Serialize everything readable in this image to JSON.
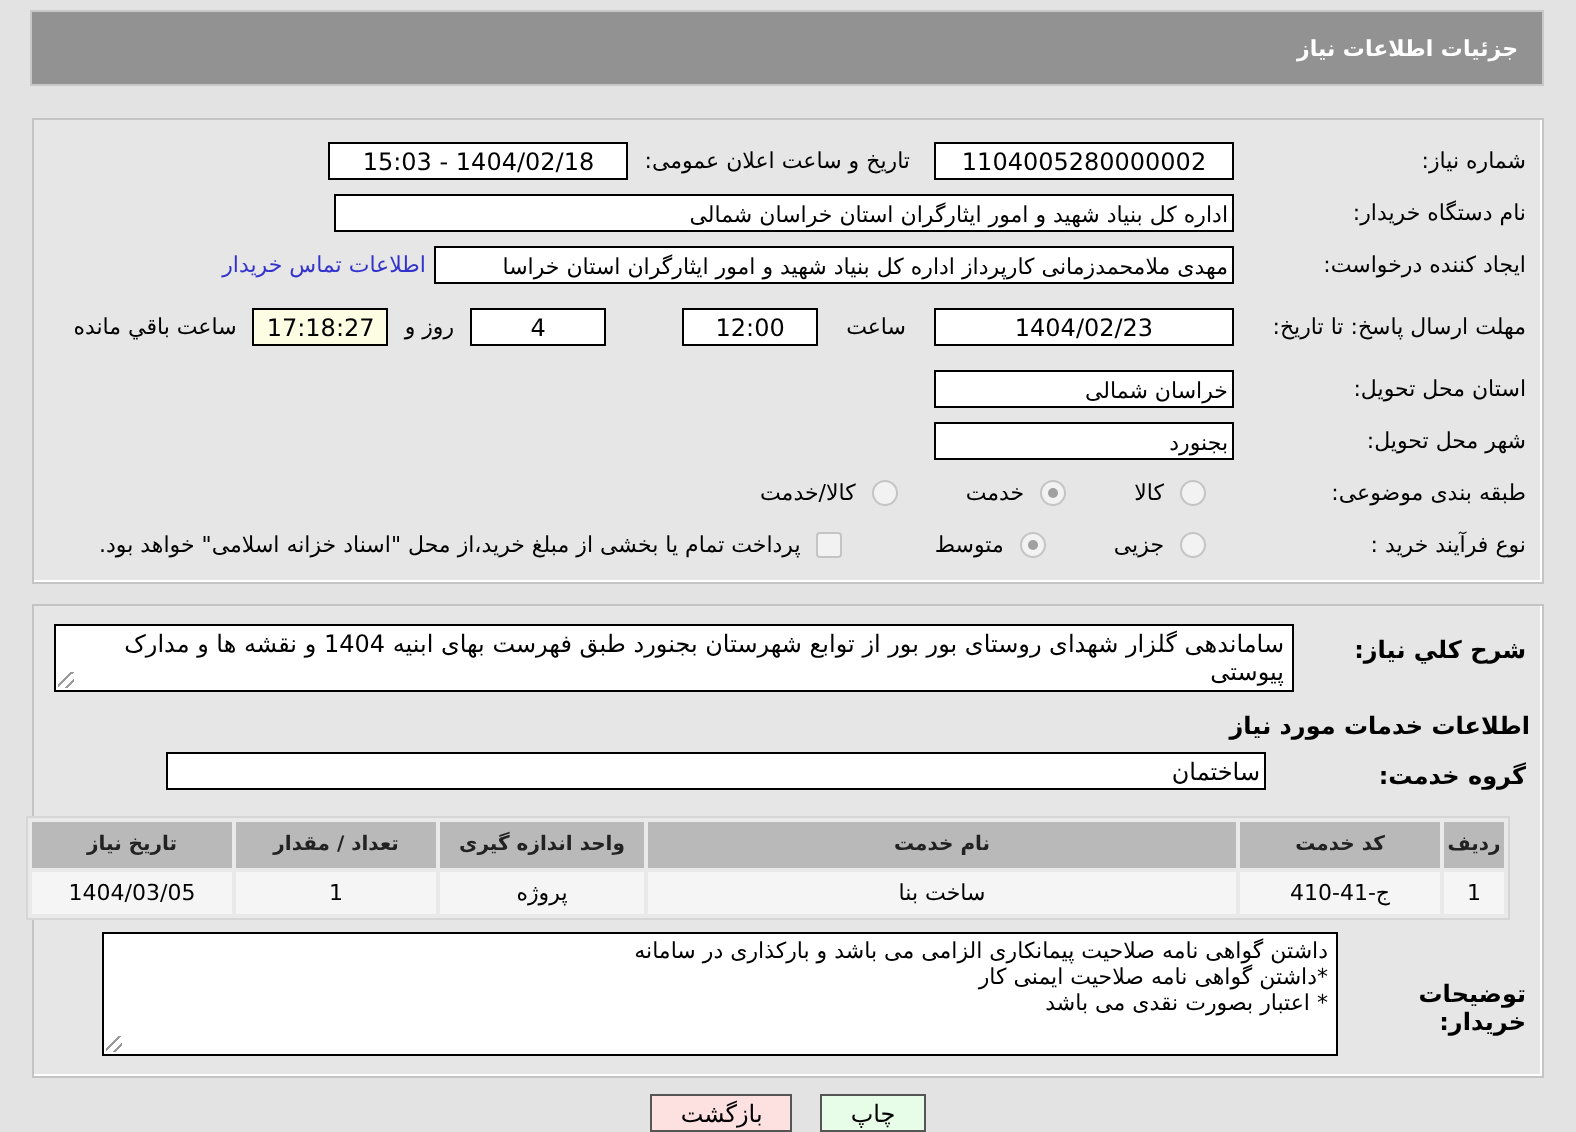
{
  "header": {
    "title": "جزئیات اطلاعات نیاز"
  },
  "need_number": {
    "label": "شماره نیاز:",
    "value": "1104005280000002"
  },
  "announce": {
    "label": "تاریخ و ساعت اعلان عمومی:",
    "value": "1404/02/18 - 15:03"
  },
  "buyer": {
    "label": "نام دستگاه خریدار:",
    "value": "اداره کل بنیاد شهید و امور ایثارگران استان خراسان شمالی"
  },
  "creator": {
    "label": "ایجاد کننده درخواست:",
    "value": "مهدی  ملامحمدزمانی کارپرداز اداره کل بنیاد شهید و امور ایثارگران استان خراسا",
    "link": "اطلاعات تماس خریدار"
  },
  "deadline": {
    "label": "مهلت ارسال پاسخ: تا تاریخ:",
    "date": "1404/02/23",
    "time_label": "ساعت",
    "time": "12:00",
    "days": "4",
    "days_label": "روز و",
    "remaining": "17:18:27",
    "remaining_label": "ساعت باقي مانده"
  },
  "province": {
    "label": "استان محل تحویل:",
    "value": "خراسان شمالی"
  },
  "city": {
    "label": "شهر محل تحویل:",
    "value": "بجنورد"
  },
  "category": {
    "label": "طبقه بندی موضوعی:",
    "options": [
      {
        "label": "کالا",
        "selected": false
      },
      {
        "label": "خدمت",
        "selected": true
      },
      {
        "label": "کالا/خدمت",
        "selected": false
      }
    ]
  },
  "process": {
    "label": "نوع فرآیند خرید :",
    "options": [
      {
        "label": "جزیی",
        "selected": false
      },
      {
        "label": "متوسط",
        "selected": true
      }
    ],
    "treasury": {
      "label": "پرداخت تمام یا بخشی از مبلغ خرید،از محل \"اسناد خزانه اسلامی\" خواهد بود.",
      "checked": false
    }
  },
  "summary": {
    "label": "شرح کلي نياز:",
    "value": "ساماندهی گلزار شهدای روستای بور بور از توابع شهرستان بجنورد طبق فهرست بهای ابنیه 1404 و نقشه ها و مدارک پیوستی"
  },
  "services_title": "اطلاعات خدمات مورد نیاز",
  "service_group": {
    "label": "گروه خدمت:",
    "value": "ساختمان"
  },
  "table": {
    "columns": [
      "ردیف",
      "کد خدمت",
      "نام خدمت",
      "واحد اندازه گیری",
      "تعداد / مقدار",
      "تاریخ نیاز"
    ],
    "rows": [
      [
        "1",
        "ج-41-410",
        "ساخت بنا",
        "پروژه",
        "1",
        "1404/03/05"
      ]
    ]
  },
  "buyer_notes": {
    "label": "توضیحات خریدار:",
    "lines": [
      "داشتن گواهی نامه صلاحیت پیمانکاری الزامی می باشد و بارکذاری در سامانه",
      "*داشتن گواهی نامه صلاحیت ایمنی کار",
      "* اعتبار بصورت نقدی می باشد"
    ]
  },
  "buttons": [
    {
      "label": "چاپ",
      "kind": "print"
    },
    {
      "label": "بازگشت",
      "kind": "back"
    }
  ]
}
